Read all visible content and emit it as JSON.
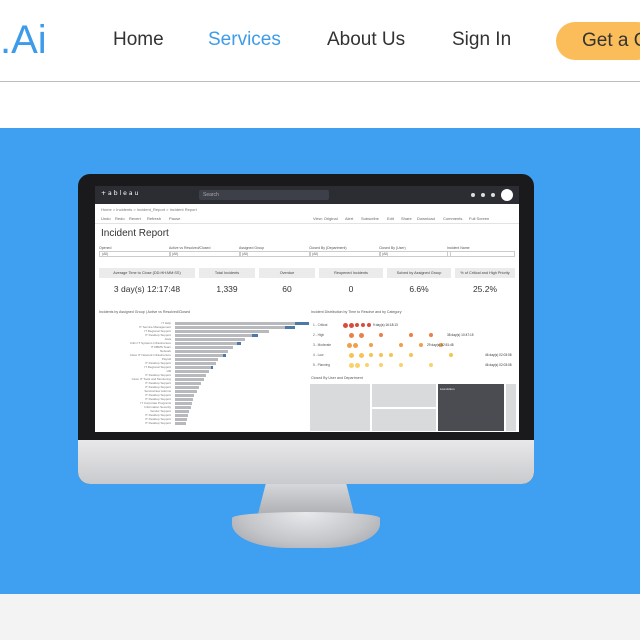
{
  "header": {
    "logo": ".Ai",
    "nav": [
      "Home",
      "Services",
      "About Us",
      "Sign In"
    ],
    "active": "Services",
    "cta_label": "Get a Q"
  },
  "colors": {
    "accent": "#3d9be9",
    "hero_bg": "#3f9ff0",
    "cta_bg": "#fbbd5a"
  },
  "dashboard": {
    "app_name": "+ableau",
    "search_placeholder": "Search",
    "breadcrumb": "Home > Incidents > Incident_Report > Incident Report",
    "title": "Incident Report",
    "toolbar": [
      "Undo",
      "Redo",
      "Revert",
      "Refresh",
      "Pause",
      "View: Original",
      "Alert",
      "Subscribe",
      "Edit",
      "Share",
      "Download",
      "Comments",
      "Full Screen"
    ],
    "filters": [
      {
        "label": "Opened",
        "value": "(All)"
      },
      {
        "label": "Active vs Resolved/Closed",
        "value": "(All)"
      },
      {
        "label": "Assigned Group",
        "value": "(All)"
      },
      {
        "label": "Closed By (Department)",
        "value": "(All)"
      },
      {
        "label": "Closed By (User)",
        "value": "(All)"
      },
      {
        "label": "Incident Name",
        "value": ""
      }
    ],
    "kpis": [
      {
        "label": "Average Time to Close (DD:HH:MM:SS)",
        "value": "3 day(s) 12:17:48"
      },
      {
        "label": "Total Incidents",
        "value": "1,339"
      },
      {
        "label": "Overdue",
        "value": "60"
      },
      {
        "label": "Reopened Incidents",
        "value": "0"
      },
      {
        "label": "Solved by Assigned Group",
        "value": "6.6%"
      },
      {
        "label": "% of Critical and High Priority",
        "value": "25.2%"
      }
    ],
    "left_panel_title": "Incidents by Assigned Group | Active vs Resolved/Closed",
    "right_panel_title": "Incident Distribution by Time to Resolve and by Category",
    "treemap_title": "Closed By User and Department",
    "bar_labels": [
      "IT Help",
      "IT Service Management",
      "IT Regional Support",
      "IT Desktop Support",
      "Java",
      "Citrix IT Systems Infrastructure",
      "IT DBMS Team",
      "Network",
      "Cisco IT Network Infrastructure",
      "Payroll",
      "IT Desktop Support",
      "IT Regional Support",
      "HR",
      "IT Desktop Support",
      "Cisco IT Tools and Monitoring",
      "IT Desktop Support",
      "IT Desktop Support",
      "ServiceNow Admins",
      "IT Desktop Support",
      "IT Desktop Support",
      "IT Corporate Programs",
      "Information Security",
      "Vendor Support",
      "IT Desktop Support",
      "IT Desktop Support",
      "IT Desktop Support"
    ],
    "priority_rows": [
      {
        "label": "1 - Critical",
        "time": "9 day(s) 16:18:13"
      },
      {
        "label": "2 - High",
        "time": "38 day(s) 10:47:15"
      },
      {
        "label": "3 - Moderate",
        "time": "29 day(s) 02:51:48"
      },
      {
        "label": "4 - Low",
        "time": "46 day(s) 02:03:08"
      },
      {
        "label": "5 - Planning",
        "time": "46 day(s) 02:03:08"
      }
    ],
    "treemap_label": "Low Action"
  }
}
